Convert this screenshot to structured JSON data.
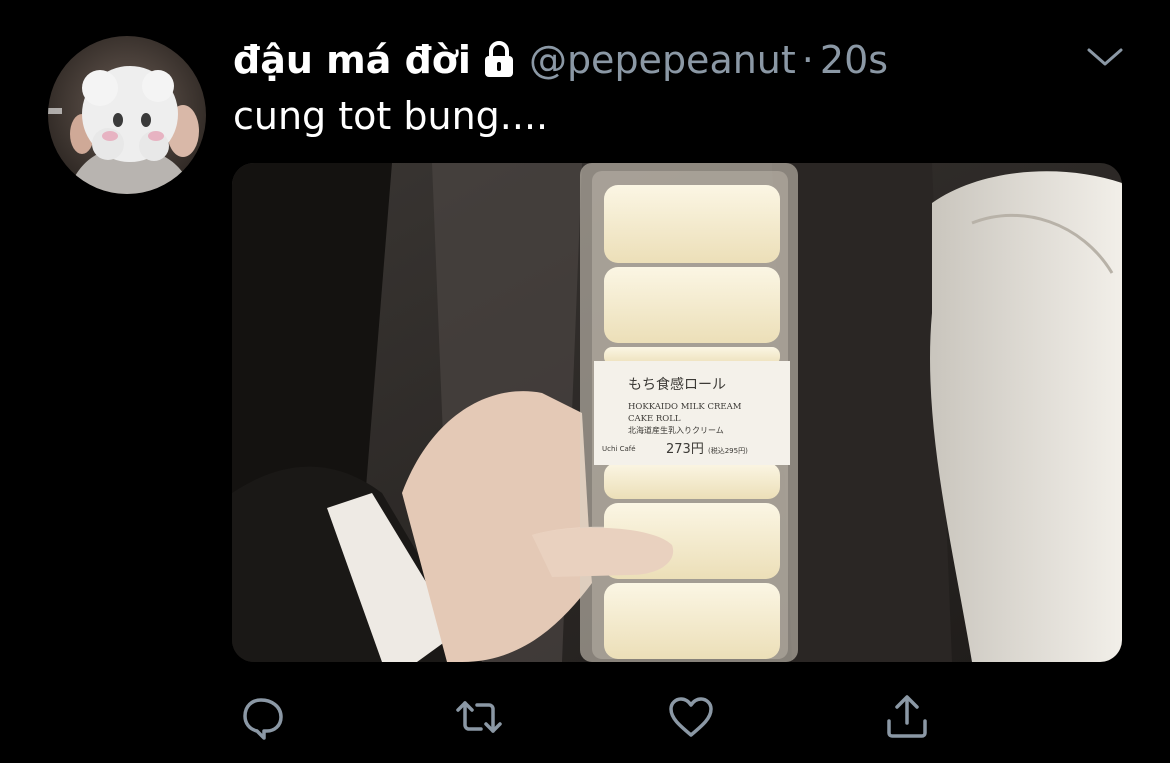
{
  "tweet": {
    "display_name": "đậu má đời",
    "handle": "@pepepeanut",
    "separator": "·",
    "time": "20s",
    "text": "cung tot bung....",
    "protected": true
  },
  "media": {
    "package_label_jp": "もち食感ロール",
    "package_label_en_1": "HOKKAIDO MILK CREAM",
    "package_label_en_2": "CAKE ROLL",
    "package_sub_jp": "北海道産生乳入りクリーム",
    "brand": "Uchi Café",
    "price": "273円",
    "price_tax": "(税込295円)"
  },
  "icons": {
    "avatar": "avatar",
    "lock": "lock-icon",
    "more": "chevron-down-icon",
    "reply": "reply-icon",
    "retweet": "retweet-icon",
    "like": "heart-icon",
    "share": "share-icon"
  },
  "colors": {
    "background": "#000000",
    "text_primary": "#ffffff",
    "text_secondary": "#8b98a5"
  }
}
